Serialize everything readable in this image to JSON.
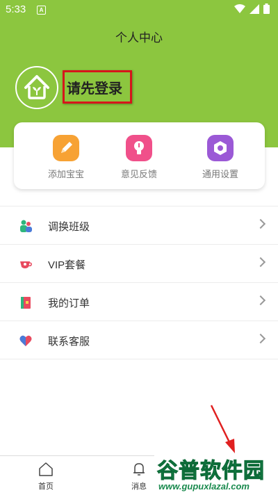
{
  "status_bar": {
    "time": "5:33",
    "notification_letter": "A"
  },
  "header": {
    "title": "个人中心"
  },
  "profile": {
    "login_prompt": "请先登录"
  },
  "quick_actions": [
    {
      "label": "添加宝宝",
      "icon": "pencil-icon",
      "color": "#f7a234"
    },
    {
      "label": "意见反馈",
      "icon": "lightbulb-icon",
      "color": "#f0508a"
    },
    {
      "label": "通用设置",
      "icon": "settings-icon",
      "color": "#9b59d6"
    }
  ],
  "menu": [
    {
      "label": "调换班级",
      "icon": "people-icon"
    },
    {
      "label": "VIP套餐",
      "icon": "cup-icon"
    },
    {
      "label": "我的订单",
      "icon": "notebook-icon"
    },
    {
      "label": "联系客服",
      "icon": "heart-chat-icon"
    }
  ],
  "tabbar": [
    {
      "label": "首页",
      "icon": "home-icon"
    },
    {
      "label": "消息",
      "icon": "bell-icon"
    }
  ],
  "watermark": {
    "main": "谷普软件园",
    "sub": "www.gupuxlazal.com"
  },
  "colors": {
    "brand_green": "#8cc63f",
    "highlight_red": "#d6161b"
  }
}
